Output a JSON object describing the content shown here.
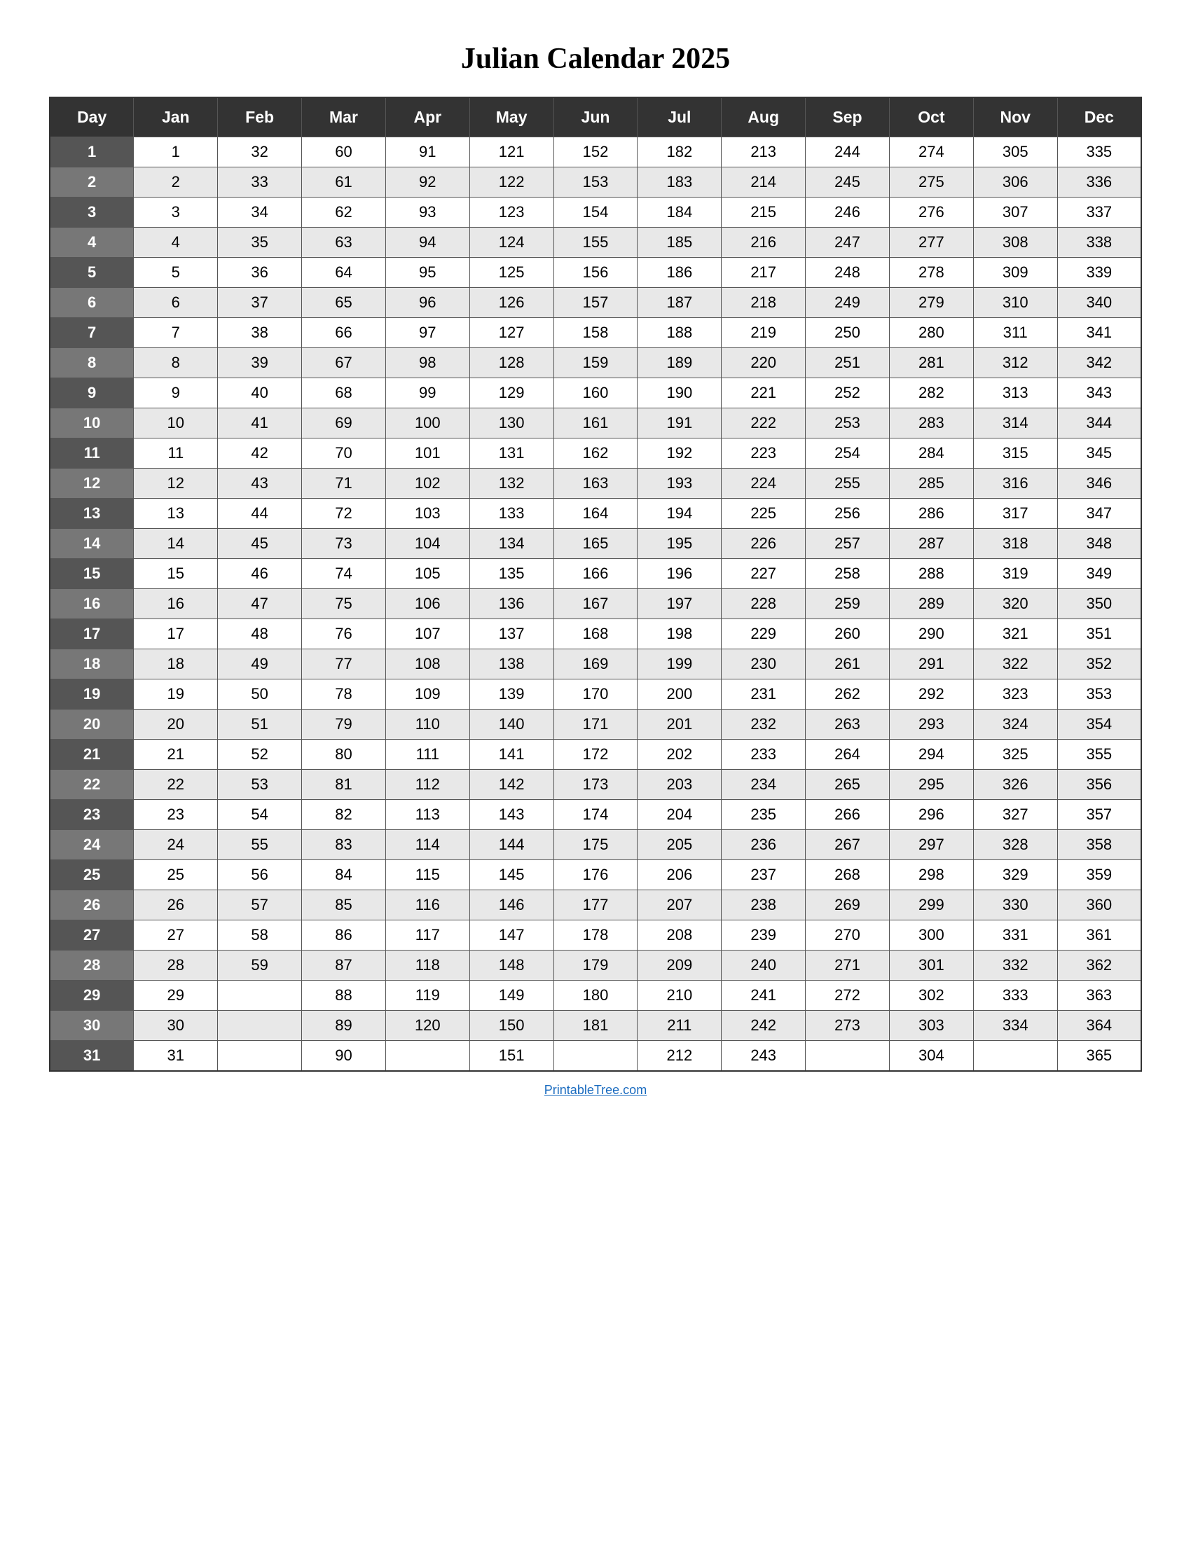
{
  "title": "Julian Calendar 2025",
  "headers": [
    "Day",
    "Jan",
    "Feb",
    "Mar",
    "Apr",
    "May",
    "Jun",
    "Jul",
    "Aug",
    "Sep",
    "Oct",
    "Nov",
    "Dec"
  ],
  "rows": [
    [
      "1",
      "1",
      "32",
      "60",
      "91",
      "121",
      "152",
      "182",
      "213",
      "244",
      "274",
      "305",
      "335"
    ],
    [
      "2",
      "2",
      "33",
      "61",
      "92",
      "122",
      "153",
      "183",
      "214",
      "245",
      "275",
      "306",
      "336"
    ],
    [
      "3",
      "3",
      "34",
      "62",
      "93",
      "123",
      "154",
      "184",
      "215",
      "246",
      "276",
      "307",
      "337"
    ],
    [
      "4",
      "4",
      "35",
      "63",
      "94",
      "124",
      "155",
      "185",
      "216",
      "247",
      "277",
      "308",
      "338"
    ],
    [
      "5",
      "5",
      "36",
      "64",
      "95",
      "125",
      "156",
      "186",
      "217",
      "248",
      "278",
      "309",
      "339"
    ],
    [
      "6",
      "6",
      "37",
      "65",
      "96",
      "126",
      "157",
      "187",
      "218",
      "249",
      "279",
      "310",
      "340"
    ],
    [
      "7",
      "7",
      "38",
      "66",
      "97",
      "127",
      "158",
      "188",
      "219",
      "250",
      "280",
      "311",
      "341"
    ],
    [
      "8",
      "8",
      "39",
      "67",
      "98",
      "128",
      "159",
      "189",
      "220",
      "251",
      "281",
      "312",
      "342"
    ],
    [
      "9",
      "9",
      "40",
      "68",
      "99",
      "129",
      "160",
      "190",
      "221",
      "252",
      "282",
      "313",
      "343"
    ],
    [
      "10",
      "10",
      "41",
      "69",
      "100",
      "130",
      "161",
      "191",
      "222",
      "253",
      "283",
      "314",
      "344"
    ],
    [
      "11",
      "11",
      "42",
      "70",
      "101",
      "131",
      "162",
      "192",
      "223",
      "254",
      "284",
      "315",
      "345"
    ],
    [
      "12",
      "12",
      "43",
      "71",
      "102",
      "132",
      "163",
      "193",
      "224",
      "255",
      "285",
      "316",
      "346"
    ],
    [
      "13",
      "13",
      "44",
      "72",
      "103",
      "133",
      "164",
      "194",
      "225",
      "256",
      "286",
      "317",
      "347"
    ],
    [
      "14",
      "14",
      "45",
      "73",
      "104",
      "134",
      "165",
      "195",
      "226",
      "257",
      "287",
      "318",
      "348"
    ],
    [
      "15",
      "15",
      "46",
      "74",
      "105",
      "135",
      "166",
      "196",
      "227",
      "258",
      "288",
      "319",
      "349"
    ],
    [
      "16",
      "16",
      "47",
      "75",
      "106",
      "136",
      "167",
      "197",
      "228",
      "259",
      "289",
      "320",
      "350"
    ],
    [
      "17",
      "17",
      "48",
      "76",
      "107",
      "137",
      "168",
      "198",
      "229",
      "260",
      "290",
      "321",
      "351"
    ],
    [
      "18",
      "18",
      "49",
      "77",
      "108",
      "138",
      "169",
      "199",
      "230",
      "261",
      "291",
      "322",
      "352"
    ],
    [
      "19",
      "19",
      "50",
      "78",
      "109",
      "139",
      "170",
      "200",
      "231",
      "262",
      "292",
      "323",
      "353"
    ],
    [
      "20",
      "20",
      "51",
      "79",
      "110",
      "140",
      "171",
      "201",
      "232",
      "263",
      "293",
      "324",
      "354"
    ],
    [
      "21",
      "21",
      "52",
      "80",
      "111",
      "141",
      "172",
      "202",
      "233",
      "264",
      "294",
      "325",
      "355"
    ],
    [
      "22",
      "22",
      "53",
      "81",
      "112",
      "142",
      "173",
      "203",
      "234",
      "265",
      "295",
      "326",
      "356"
    ],
    [
      "23",
      "23",
      "54",
      "82",
      "113",
      "143",
      "174",
      "204",
      "235",
      "266",
      "296",
      "327",
      "357"
    ],
    [
      "24",
      "24",
      "55",
      "83",
      "114",
      "144",
      "175",
      "205",
      "236",
      "267",
      "297",
      "328",
      "358"
    ],
    [
      "25",
      "25",
      "56",
      "84",
      "115",
      "145",
      "176",
      "206",
      "237",
      "268",
      "298",
      "329",
      "359"
    ],
    [
      "26",
      "26",
      "57",
      "85",
      "116",
      "146",
      "177",
      "207",
      "238",
      "269",
      "299",
      "330",
      "360"
    ],
    [
      "27",
      "27",
      "58",
      "86",
      "117",
      "147",
      "178",
      "208",
      "239",
      "270",
      "300",
      "331",
      "361"
    ],
    [
      "28",
      "28",
      "59",
      "87",
      "118",
      "148",
      "179",
      "209",
      "240",
      "271",
      "301",
      "332",
      "362"
    ],
    [
      "29",
      "29",
      "",
      "88",
      "119",
      "149",
      "180",
      "210",
      "241",
      "272",
      "302",
      "333",
      "363"
    ],
    [
      "30",
      "30",
      "",
      "89",
      "120",
      "150",
      "181",
      "211",
      "242",
      "273",
      "303",
      "334",
      "364"
    ],
    [
      "31",
      "31",
      "",
      "90",
      "",
      "151",
      "",
      "212",
      "243",
      "",
      "304",
      "",
      "365"
    ]
  ],
  "footer": "PrintableTree.com"
}
